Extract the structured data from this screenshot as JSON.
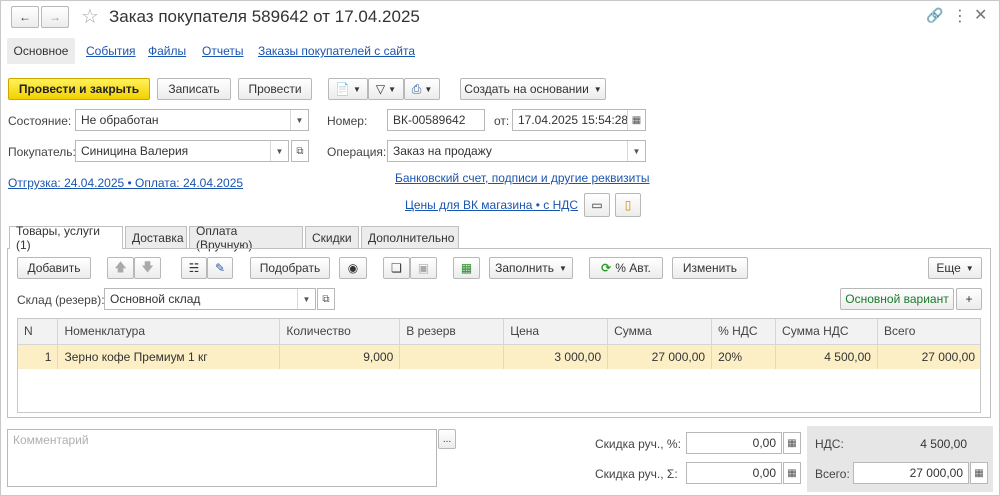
{
  "window": {
    "title": "Заказ покупателя 589642 от 17.04.2025"
  },
  "nav_tabs": [
    "Основное",
    "События",
    "Файлы",
    "Отчеты",
    "Заказы покупателей с сайта"
  ],
  "toolbar": {
    "post_close": "Провести и закрыть",
    "save": "Записать",
    "post": "Провести",
    "create_based": "Создать на основании"
  },
  "form": {
    "state_label": "Состояние:",
    "state_value": "Не обработан",
    "number_label": "Номер:",
    "number_value": "ВК-00589642",
    "date_label": "от:",
    "date_value": "17.04.2025 15:54:28",
    "buyer_label": "Покупатель:",
    "buyer_value": "Синицина Валерия",
    "operation_label": "Операция:",
    "operation_value": "Заказ на продажу",
    "shipment_link": "Отгрузка: 24.04.2025 • Оплата: 24.04.2025",
    "bank_link": "Банковский счет, подписи и другие реквизиты",
    "prices_link": "Цены для ВК магазина • с НДС"
  },
  "section_tabs": [
    "Товары, услуги (1)",
    "Доставка",
    "Оплата (Вручную)",
    "Скидки",
    "Дополнительно"
  ],
  "goods_toolbar": {
    "add": "Добавить",
    "pick": "Подобрать",
    "fill": "Заполнить",
    "auto_percent": "% Авт.",
    "change": "Изменить",
    "more": "Еще"
  },
  "warehouse": {
    "label": "Склад (резерв):",
    "value": "Основной склад",
    "variant": "Основной вариант",
    "plus": "+"
  },
  "table": {
    "headers": [
      "N",
      "Номенклатура",
      "Количество",
      "В резерв",
      "Цена",
      "Сумма",
      "% НДС",
      "Сумма НДС",
      "Всего"
    ],
    "rows": [
      {
        "n": "1",
        "name": "Зерно кофе Премиум 1 кг",
        "qty": "9,000",
        "reserve": "",
        "price": "3 000,00",
        "sum": "27 000,00",
        "vat_rate": "20%",
        "vat_sum": "4 500,00",
        "total": "27 000,00"
      }
    ]
  },
  "footer": {
    "comment_placeholder": "Комментарий",
    "comment_btn": "...",
    "discount_pct_label": "Скидка руч., %:",
    "discount_pct_value": "0,00",
    "discount_sum_label": "Скидка руч., Σ:",
    "discount_sum_value": "0,00",
    "vat_label": "НДС:",
    "vat_value": "4 500,00",
    "total_label": "Всего:",
    "total_value": "27 000,00"
  }
}
